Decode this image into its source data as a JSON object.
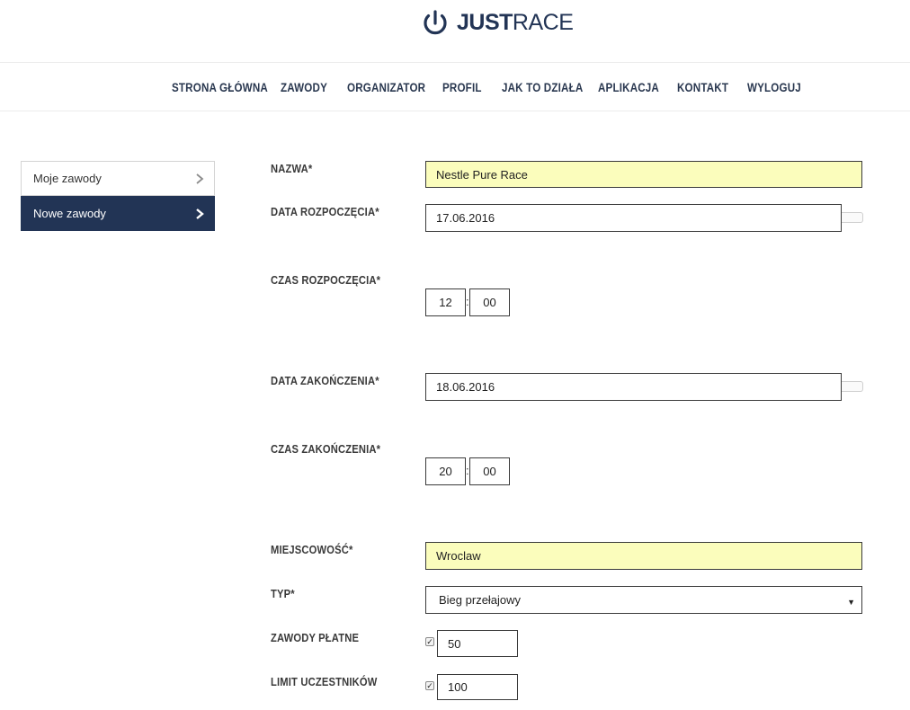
{
  "brand": {
    "logo_bold": "JUST",
    "logo_light": "RACE",
    "logo_icon": "stopwatch-icon"
  },
  "nav": [
    "STRONA GŁÓWNA",
    "ZAWODY",
    "ORGANIZATOR",
    "PROFIL",
    "JAK TO DZIAŁA",
    "APLIKACJA",
    "KONTAKT",
    "WYLOGUJ"
  ],
  "sidebar": {
    "items": [
      {
        "label": "Moje zawody",
        "icon": "chevron-right-icon",
        "active": false
      },
      {
        "label": "Nowe zawody",
        "icon": "chevron-right-icon",
        "active": true
      }
    ]
  },
  "form": {
    "name": {
      "label": "NAZWA*",
      "value": "Nestle Pure Race"
    },
    "start_date": {
      "label": "DATA ROZPOCZĘCIA*",
      "value": "17.06.2016"
    },
    "start_time": {
      "label": "CZAS ROZPOCZĘCIA*",
      "hour": "12",
      "minute": "00",
      "separator": ":"
    },
    "end_date": {
      "label": "DATA ZAKOŃCZENIA*",
      "value": "18.06.2016"
    },
    "end_time": {
      "label": "CZAS ZAKOŃCZENIA*",
      "hour": "20",
      "minute": "00",
      "separator": ":"
    },
    "city": {
      "label": "MIEJSCOWOŚĆ*",
      "value": "Wroclaw"
    },
    "type": {
      "label": "TYP*",
      "value": "Bieg przełajowy"
    },
    "paid": {
      "label": "ZAWODY PŁATNE",
      "checked": true,
      "value": "50"
    },
    "limit": {
      "label": "LIMIT UCZESTNIKÓW",
      "checked": true,
      "value": "100"
    }
  },
  "colors": {
    "brand_navy": "#223455",
    "highlight_yellow": "#fbfdbc",
    "nav_text": "#2a3850"
  }
}
